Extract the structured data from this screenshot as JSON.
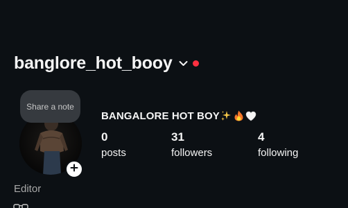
{
  "profile": {
    "username": "banglore_hot_booy",
    "display_name": "BANGALORE HOT BOY",
    "bio_emojis": [
      "sparkles-icon",
      "fire-icon",
      "white-heart-icon"
    ],
    "note_prompt": "Share a note",
    "category": "Editor",
    "bio_line_icon": "glasses-icon"
  },
  "stats": [
    {
      "count": "0",
      "label": "posts"
    },
    {
      "count": "31",
      "label": "followers"
    },
    {
      "count": "4",
      "label": "following"
    }
  ],
  "icons": {
    "username_menu": "chevron-down-icon",
    "live_indicator": "red-dot",
    "avatar_action": "plus-icon"
  },
  "colors": {
    "background": "#0c1014",
    "text_primary": "#f5f5f5",
    "text_secondary": "#a8a8a8",
    "note_bubble": "#363a3f",
    "notification_dot": "#ff3040"
  }
}
